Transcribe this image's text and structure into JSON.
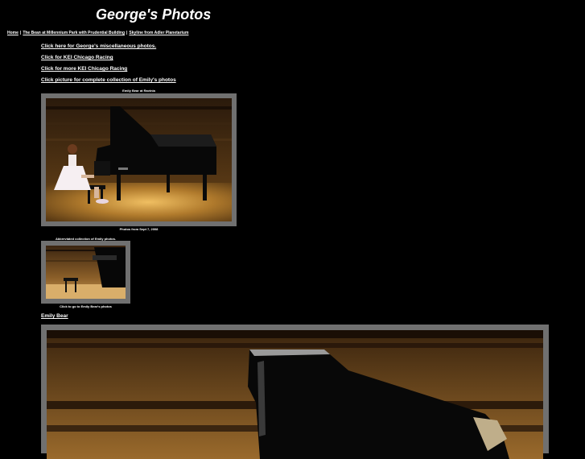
{
  "header": {
    "title": "George's Photos"
  },
  "nav": {
    "items": [
      "Home",
      "The Bean at Millennium Park with Prudential Building",
      "Skyline from Adler Planetarium"
    ]
  },
  "links": [
    "Click here for George's miscellaneous photos.",
    "Click for KEI Chicago Racing",
    "Click for more KEI Chicago Racing",
    "Click picture for complete collection of Emily's photos"
  ],
  "captions": {
    "photo1_top": "Emily Bear at Ravinia",
    "photo1_bottom": "Photos from Sept 7, 2008",
    "photo2_top": "Abbreviated collection of Emily photos.",
    "photo2_bottom": "Click to go to Emily Bear's photos"
  },
  "emily_link": "Emily Bear",
  "colors": {
    "background": "#000000",
    "frame": "#707070",
    "stage_wood": "#8a5a1c",
    "stage_highlight": "#e0a84a"
  }
}
